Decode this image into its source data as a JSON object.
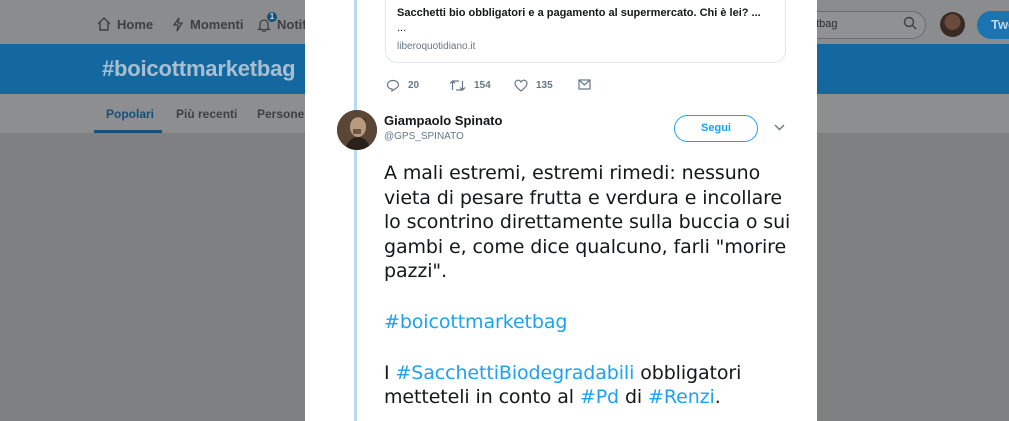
{
  "topnav": {
    "home_label": "Home",
    "moments_label": "Momenti",
    "notifications_label": "Notifi",
    "notifications_badge": "1",
    "search_value": "etbag",
    "tweet_button": "Twe"
  },
  "banner": {
    "title": "#boicottmarketbag"
  },
  "subnav": {
    "items": [
      "Popolari",
      "Più recenti",
      "Persone"
    ]
  },
  "card": {
    "title": "Sacchetti bio obbligatori e a pagamento al supermercato. Chi è lei? ...",
    "ellipsis": "...",
    "domain": "liberoquotidiano.it"
  },
  "actions": {
    "replies": "20",
    "retweets": "154",
    "likes": "135"
  },
  "tweet": {
    "name": "Giampaolo Spinato",
    "handle": "@GPS_SPINATO",
    "follow_label": "Segui",
    "line1": "A mali estremi, estremi rimedi: nessuno vieta di pesare frutta e verdura e incollare lo scontrino direttamente sulla buccia o sui gambi e, come dice qualcuno, farli \"morire pazzi\".",
    "hashtag1": "#boicottmarketbag",
    "p3_start": "I ",
    "p3_tag1": "#SacchettiBiodegradabili",
    "p3_mid": " obbligatori metteteli in conto al ",
    "p3_tag2": "#Pd",
    "p3_di": " di ",
    "p3_tag3": "#Renzi",
    "p3_end": "."
  },
  "colors": {
    "accent": "#1da1f2",
    "thread_line": "#b7dbf3",
    "banner": "#12689f"
  }
}
